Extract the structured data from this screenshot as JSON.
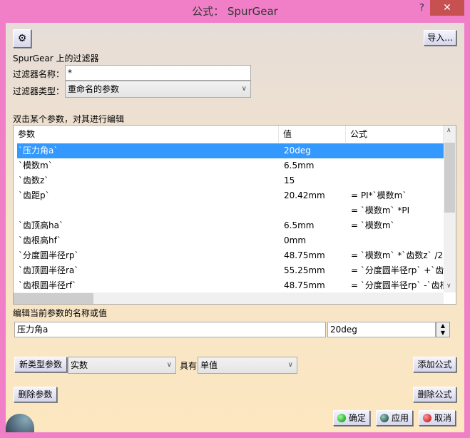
{
  "window": {
    "title": "公式： SpurGear",
    "help": "?",
    "close": "✕"
  },
  "toolbar": {
    "import_label": "导入..."
  },
  "filter": {
    "heading": "SpurGear 上的过滤器",
    "name_label": "过滤器名称：",
    "name_value": "*",
    "type_label": "过滤器类型：",
    "type_value": "重命名的参数"
  },
  "list": {
    "caption": "双击某个参数，对其进行编辑",
    "columns": [
      "参数",
      "值",
      "公式"
    ],
    "rows": [
      {
        "name": "`压力角a`",
        "value": "20deg",
        "formula": "",
        "selected": true
      },
      {
        "name": "`模数m`",
        "value": "6.5mm",
        "formula": ""
      },
      {
        "name": "`齿数z`",
        "value": "15",
        "formula": ""
      },
      {
        "name": "`齿距p`",
        "value": "20.42mm",
        "formula": "= PI*`模数m`"
      },
      {
        "name": "",
        "value": "",
        "formula": "= `模数m` *PI"
      },
      {
        "name": "`齿顶高ha`",
        "value": "6.5mm",
        "formula": "= `模数m`"
      },
      {
        "name": "`齿根高hf`",
        "value": "0mm",
        "formula": ""
      },
      {
        "name": "`分度圆半径rp`",
        "value": "48.75mm",
        "formula": "= `模数m` *`齿数z` /2"
      },
      {
        "name": "`齿顶圆半径ra`",
        "value": "55.25mm",
        "formula": "= `分度圆半径rp` +`齿顶"
      },
      {
        "name": "`齿根圆半径rf`",
        "value": "48.75mm",
        "formula": "= `分度圆半径rp` -`齿根"
      }
    ]
  },
  "edit": {
    "label": "编辑当前参数的名称或值",
    "name_value": "压力角a",
    "value": "20deg"
  },
  "new_param": {
    "button": "新类型参数",
    "type_value": "实数",
    "with_label": "具有",
    "mode_value": "单值",
    "add_formula": "添加公式"
  },
  "delete_param": "删除参数",
  "delete_formula": "删除公式",
  "footer": {
    "ok": "确定",
    "apply": "应用",
    "cancel": "取消"
  }
}
